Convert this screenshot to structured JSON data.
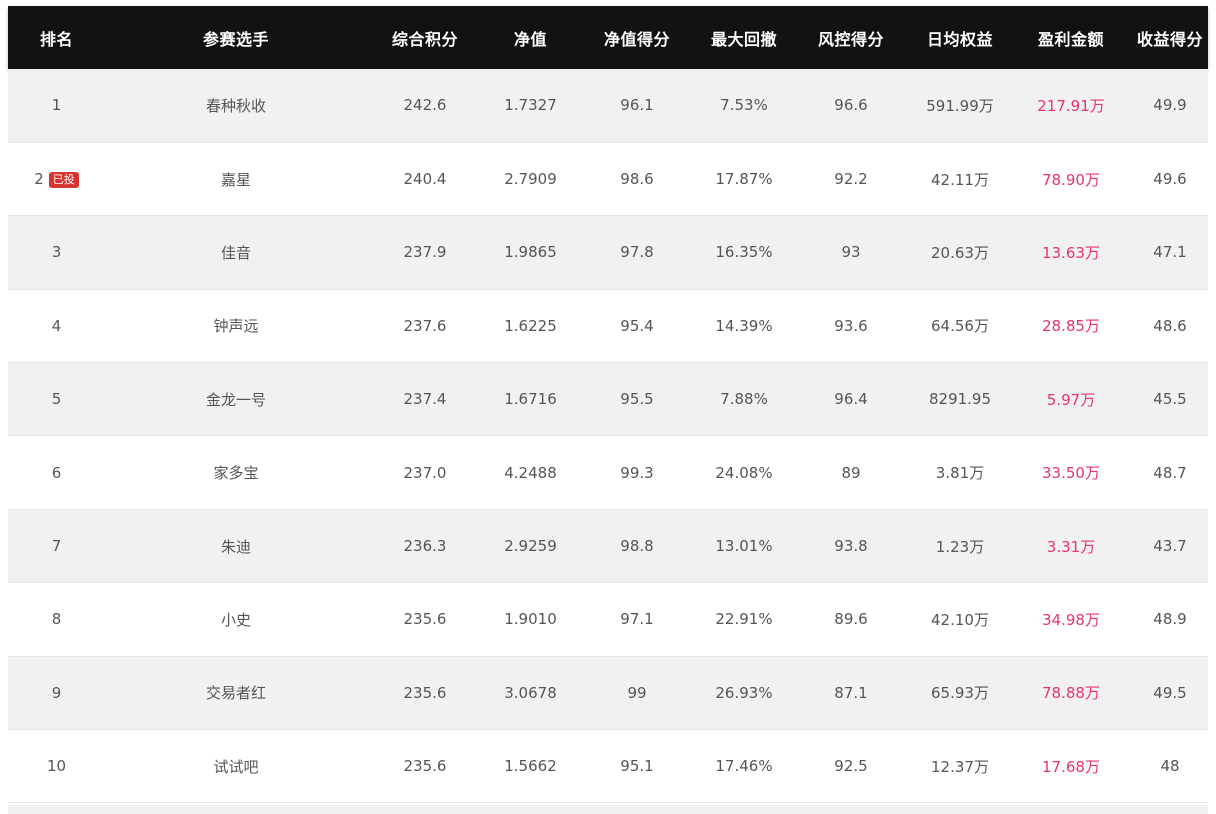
{
  "table": {
    "headers": [
      "排名",
      "参赛选手",
      "综合积分",
      "净值",
      "净值得分",
      "最大回撤",
      "风控得分",
      "日均权益",
      "盈利金额",
      "收益得分"
    ],
    "rows": [
      {
        "rank": "1",
        "badge": "",
        "player": "春种秋收",
        "score": "242.6",
        "nav": "1.7327",
        "nav_score": "96.1",
        "max_drawdown": "7.53%",
        "risk_score": "96.6",
        "avg_equity": "591.99万",
        "profit": "217.91万",
        "return_score": "49.9"
      },
      {
        "rank": "2",
        "badge": "已投",
        "player": "嘉星",
        "score": "240.4",
        "nav": "2.7909",
        "nav_score": "98.6",
        "max_drawdown": "17.87%",
        "risk_score": "92.2",
        "avg_equity": "42.11万",
        "profit": "78.90万",
        "return_score": "49.6"
      },
      {
        "rank": "3",
        "badge": "",
        "player": "佳音",
        "score": "237.9",
        "nav": "1.9865",
        "nav_score": "97.8",
        "max_drawdown": "16.35%",
        "risk_score": "93",
        "avg_equity": "20.63万",
        "profit": "13.63万",
        "return_score": "47.1"
      },
      {
        "rank": "4",
        "badge": "",
        "player": "钟声远",
        "score": "237.6",
        "nav": "1.6225",
        "nav_score": "95.4",
        "max_drawdown": "14.39%",
        "risk_score": "93.6",
        "avg_equity": "64.56万",
        "profit": "28.85万",
        "return_score": "48.6"
      },
      {
        "rank": "5",
        "badge": "",
        "player": "金龙一号",
        "score": "237.4",
        "nav": "1.6716",
        "nav_score": "95.5",
        "max_drawdown": "7.88%",
        "risk_score": "96.4",
        "avg_equity": "8291.95",
        "profit": "5.97万",
        "return_score": "45.5"
      },
      {
        "rank": "6",
        "badge": "",
        "player": "家多宝",
        "score": "237.0",
        "nav": "4.2488",
        "nav_score": "99.3",
        "max_drawdown": "24.08%",
        "risk_score": "89",
        "avg_equity": "3.81万",
        "profit": "33.50万",
        "return_score": "48.7"
      },
      {
        "rank": "7",
        "badge": "",
        "player": "朱迪",
        "score": "236.3",
        "nav": "2.9259",
        "nav_score": "98.8",
        "max_drawdown": "13.01%",
        "risk_score": "93.8",
        "avg_equity": "1.23万",
        "profit": "3.31万",
        "return_score": "43.7"
      },
      {
        "rank": "8",
        "badge": "",
        "player": "小史",
        "score": "235.6",
        "nav": "1.9010",
        "nav_score": "97.1",
        "max_drawdown": "22.91%",
        "risk_score": "89.6",
        "avg_equity": "42.10万",
        "profit": "34.98万",
        "return_score": "48.9"
      },
      {
        "rank": "9",
        "badge": "",
        "player": "交易者红",
        "score": "235.6",
        "nav": "3.0678",
        "nav_score": "99",
        "max_drawdown": "26.93%",
        "risk_score": "87.1",
        "avg_equity": "65.93万",
        "profit": "78.88万",
        "return_score": "49.5"
      },
      {
        "rank": "10",
        "badge": "",
        "player": "试试吧",
        "score": "235.6",
        "nav": "1.5662",
        "nav_score": "95.1",
        "max_drawdown": "17.46%",
        "risk_score": "92.5",
        "avg_equity": "12.37万",
        "profit": "17.68万",
        "return_score": "48"
      }
    ]
  },
  "colors": {
    "header_bg": "#121212",
    "header_text": "#ffffff",
    "row_odd_bg": "#f1f1f1",
    "row_even_bg": "#ffffff",
    "body_text": "#555555",
    "profit_text": "#e8336d",
    "badge_bg": "#d9332f"
  }
}
